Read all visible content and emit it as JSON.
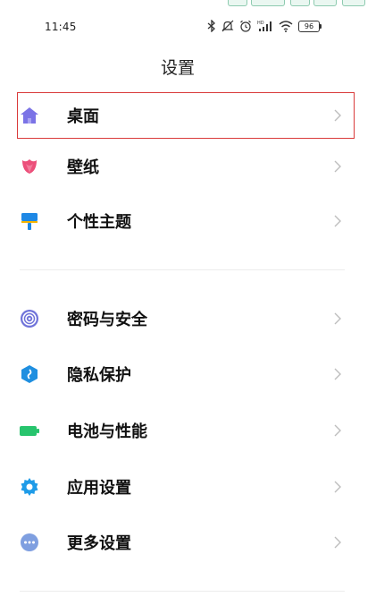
{
  "status_bar": {
    "time": "11:45",
    "battery": "96",
    "network_type": "HD"
  },
  "header": {
    "title": "设置"
  },
  "settings": {
    "group1": [
      {
        "label": "桌面",
        "icon": "home-icon",
        "color": "#7b73e6",
        "selected": true
      },
      {
        "label": "壁纸",
        "icon": "tulip-icon",
        "color": "#ec4f7a"
      },
      {
        "label": "个性主题",
        "icon": "paintbrush-icon",
        "color": "#1e88e5"
      }
    ],
    "group2": [
      {
        "label": "密码与安全",
        "icon": "fingerprint-icon",
        "color": "#6f73d9"
      },
      {
        "label": "隐私保护",
        "icon": "shield-icon",
        "color": "#1f8fe0"
      },
      {
        "label": "电池与性能",
        "icon": "battery-icon",
        "color": "#27c46d"
      },
      {
        "label": "应用设置",
        "icon": "gear-icon",
        "color": "#1e9be8"
      },
      {
        "label": "更多设置",
        "icon": "more-icon",
        "color": "#7f9fe0"
      }
    ]
  },
  "colors": {
    "highlight": "#d93a3a",
    "chevron": "#bdbdbd",
    "divider": "#ececec"
  }
}
